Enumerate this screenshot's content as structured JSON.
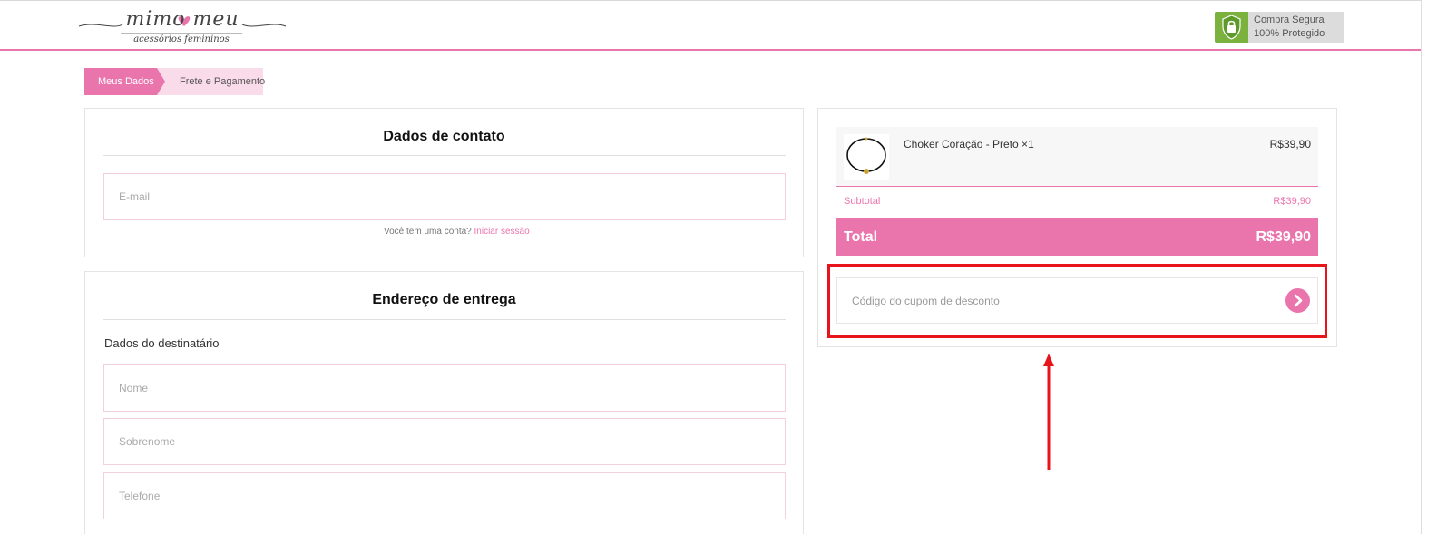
{
  "header": {
    "logo": {
      "script": "mimo meu",
      "tagline": "acessórios femininos"
    },
    "secure_badge": {
      "line1": "Compra Segura",
      "line2": "100% Protegido"
    }
  },
  "steps": [
    {
      "label": "Meus Dados",
      "active": true
    },
    {
      "label": "Frete e Pagamento",
      "active": false
    }
  ],
  "contact": {
    "title": "Dados de contato",
    "email_placeholder": "E-mail",
    "account_prompt": "Você tem uma conta?",
    "login_link": "Iniciar sessão"
  },
  "shipping": {
    "title": "Endereço de entrega",
    "recipient_label": "Dados do destinatário",
    "name_placeholder": "Nome",
    "surname_placeholder": "Sobrenome",
    "phone_placeholder": "Telefone"
  },
  "order": {
    "items": [
      {
        "name": "Choker Coração - Preto ×1",
        "price": "R$39,90"
      }
    ],
    "subtotal_label": "Subtotal",
    "subtotal_value": "R$39,90",
    "total_label": "Total",
    "total_value": "R$39,90",
    "coupon_placeholder": "Código do cupom de desconto"
  },
  "colors": {
    "brand_pink": "#ea75ad",
    "light_pink": "#fadbe9",
    "secure_green": "#7bb23e",
    "highlight_red": "#e8141c"
  }
}
